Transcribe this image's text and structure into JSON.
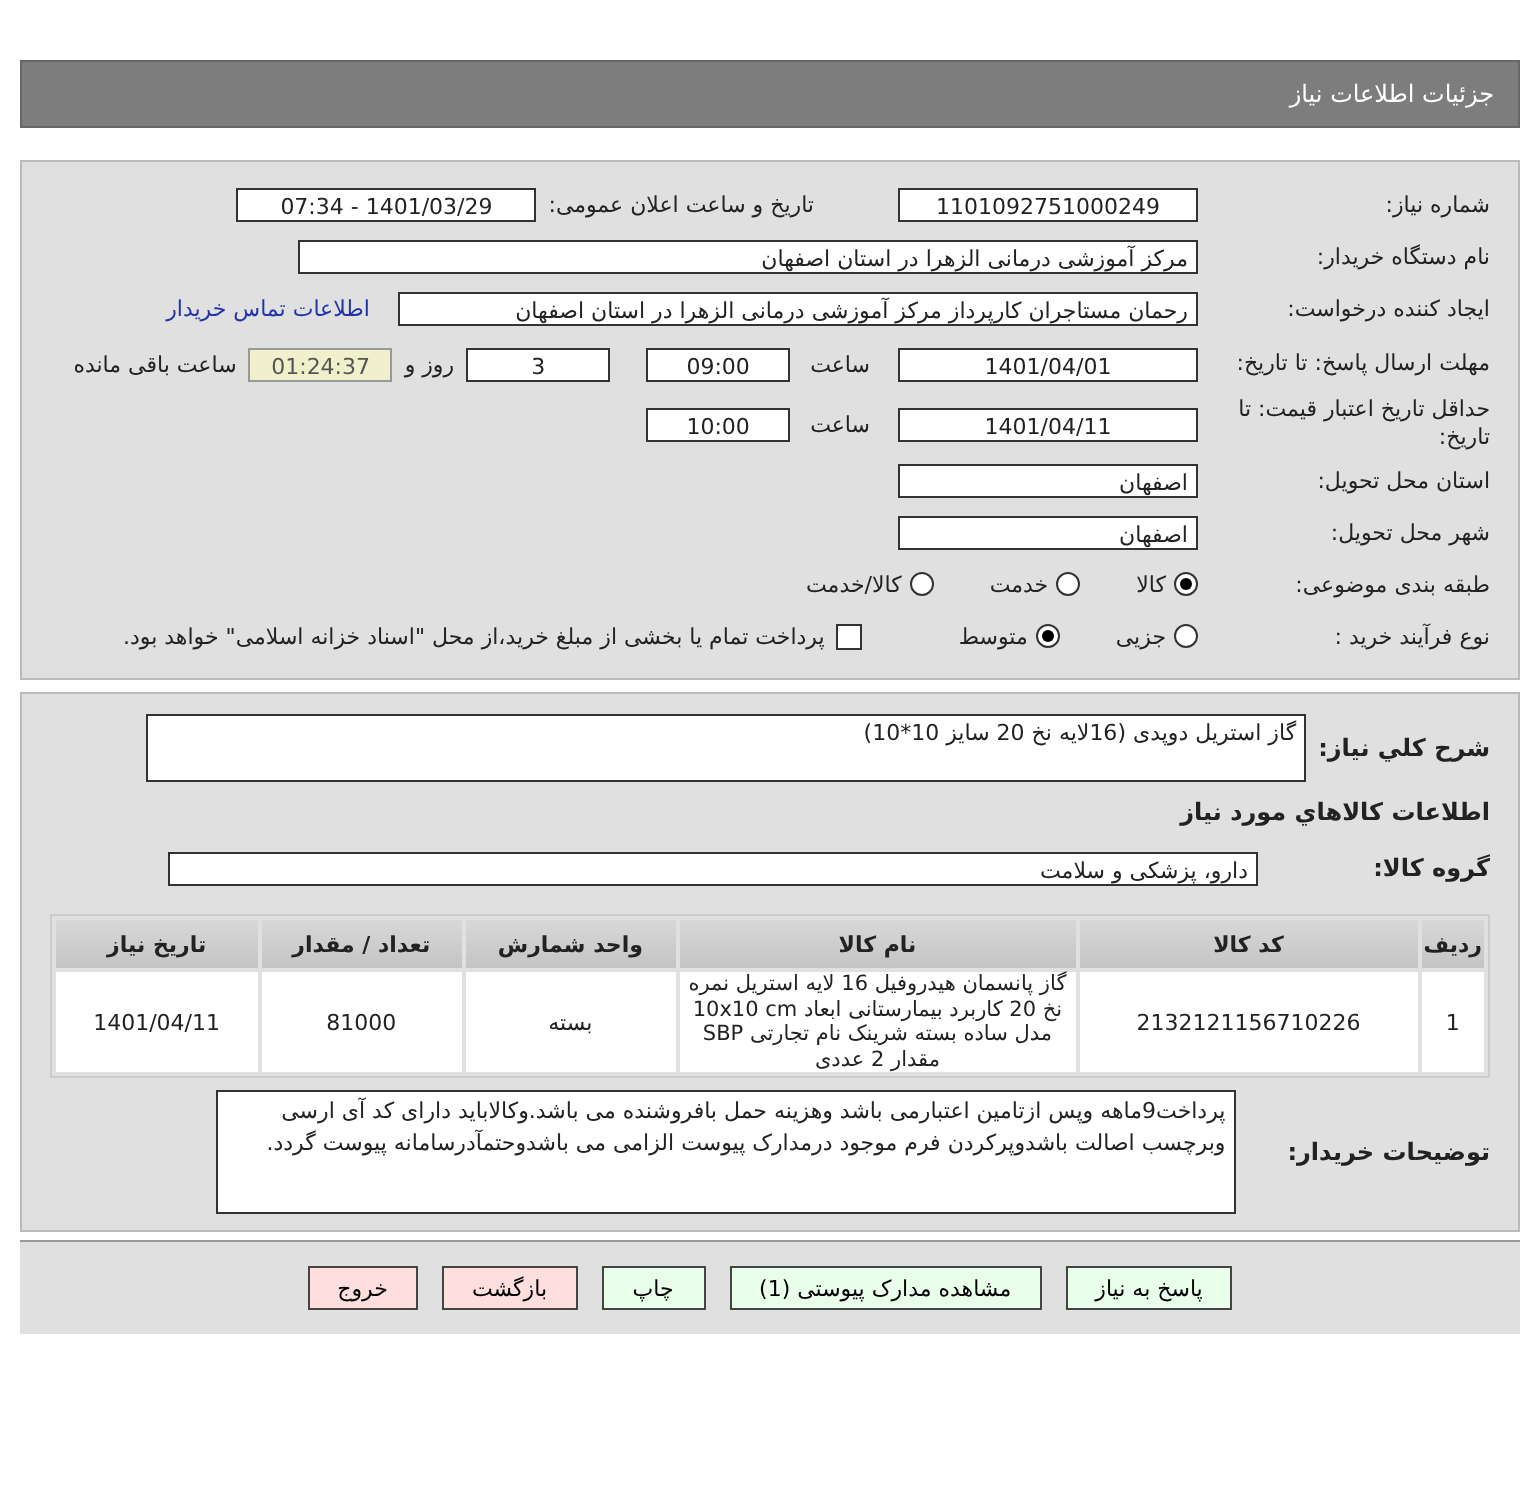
{
  "header": {
    "title": "جزئیات اطلاعات نیاز"
  },
  "need": {
    "number": {
      "label": "شماره نیاز:",
      "value": "1101092751000249"
    },
    "announce": {
      "label": "تاریخ و ساعت اعلان عمومی:",
      "value": "1401/03/29 - 07:34"
    },
    "buyer": {
      "label": "نام دستگاه خریدار:",
      "value": "مرکز آموزشی درمانی الزهرا در استان اصفهان"
    },
    "requester": {
      "label": "ایجاد کننده درخواست:",
      "value": "رحمان مستاجران کارپرداز مرکز آموزشی درمانی الزهرا در استان اصفهان",
      "link": "اطلاعات تماس خریدار"
    },
    "deadline": {
      "label": "مهلت ارسال پاسخ: تا تاریخ:",
      "date": "1401/04/01",
      "time_label": "ساعت",
      "time": "09:00",
      "days": "3",
      "days_label": "روز و",
      "remaining": "01:24:37",
      "remaining_label": "ساعت باقی مانده"
    },
    "validity": {
      "label": "حداقل تاریخ اعتبار قیمت: تا تاریخ:",
      "date": "1401/04/11",
      "time_label": "ساعت",
      "time": "10:00"
    },
    "province": {
      "label": "استان محل تحویل:",
      "value": "اصفهان"
    },
    "city": {
      "label": "شهر محل تحویل:",
      "value": "اصفهان"
    },
    "category": {
      "label": "طبقه بندی موضوعی:",
      "options": [
        {
          "label": "کالا",
          "selected": true
        },
        {
          "label": "خدمت",
          "selected": false
        },
        {
          "label": "کالا/خدمت",
          "selected": false
        }
      ]
    },
    "process": {
      "label": "نوع فرآیند خرید :",
      "options": [
        {
          "label": "جزیی",
          "selected": false
        },
        {
          "label": "متوسط",
          "selected": true
        }
      ],
      "treasury": {
        "checked": false,
        "text": "پرداخت تمام یا بخشی از مبلغ خرید،از محل \"اسناد خزانه اسلامی\" خواهد بود."
      }
    }
  },
  "details": {
    "summary": {
      "label": "شرح کلي نياز:",
      "value": "گاز استریل دوپدی (16لایه نخ 20 سایز 10*10)"
    },
    "goods_heading": "اطلاعات كالاهاي مورد نياز",
    "group": {
      "label": "گروه کالا:",
      "value": "دارو، پزشکی و سلامت"
    },
    "table": {
      "columns": [
        "ردیف",
        "کد کالا",
        "نام کالا",
        "واحد شمارش",
        "تعداد / مقدار",
        "تاریخ نیاز"
      ],
      "rows": [
        [
          "1",
          "2132121156710226",
          "گاز پانسمان هیدروفیل 16 لایه استریل نمره نخ 20 کاربرد بیمارستانی ابعاد 10x10 cm مدل ساده بسته شرینک نام تجارتی SBP مقدار 2 عددی",
          "بسته",
          "81000",
          "1401/04/11"
        ]
      ]
    },
    "notes": {
      "label": "توضیحات خریدار:",
      "value": "پرداخت9ماهه وپس ازتامین اعتبارمی باشد وهزینه حمل بافروشنده می باشد.وکالاباید دارای کد آی ارسی وبرچسب اصالت باشدوپرکردن فرم موجود درمدارک پیوست الزامی می باشدوحتمآدرسامانه پیوست گردد."
    }
  },
  "buttons": [
    {
      "label": "پاسخ به نیاز",
      "kind": "action"
    },
    {
      "label": "مشاهده مدارک پیوستی (1)",
      "kind": "action"
    },
    {
      "label": "چاپ",
      "kind": "action"
    },
    {
      "label": "بازگشت",
      "kind": "exit"
    },
    {
      "label": "خروج",
      "kind": "exit"
    }
  ]
}
